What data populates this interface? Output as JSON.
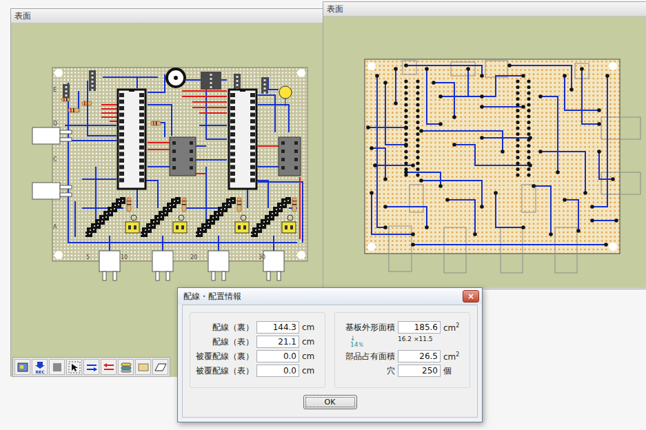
{
  "windows": [
    {
      "title": "表面",
      "kind": "front"
    },
    {
      "title": "表面",
      "kind": "back"
    }
  ],
  "front_board": {
    "row_labels": [
      "E",
      "D",
      "C",
      "A"
    ],
    "column_labels": [
      "5",
      "10",
      "20",
      "30"
    ]
  },
  "toolbar": {
    "rec_label": "REC"
  },
  "dialog": {
    "title": "配線・配置情報",
    "close": "×",
    "wiring": [
      {
        "label": "配線（裏）",
        "value": "144.3",
        "unit": "cm"
      },
      {
        "label": "配線（表）",
        "value": "21.1",
        "unit": "cm"
      },
      {
        "label": "被覆配線（裏）",
        "value": "0.0",
        "unit": "cm"
      },
      {
        "label": "被覆配線（表）",
        "value": "0.0",
        "unit": "cm"
      }
    ],
    "board_area": {
      "label": "基板外形面積",
      "value": "185.6",
      "unit": "cm",
      "unit_sup": "2",
      "dimensions": "16.2 ×11.5"
    },
    "ratio": {
      "arrow": "↓",
      "value": "14％"
    },
    "parts_area": {
      "label": "部品占有面積",
      "value": "26.5",
      "unit": "cm",
      "unit_sup": "2"
    },
    "holes": {
      "label": "穴",
      "value": "250",
      "unit": "個"
    },
    "buttons": [
      "OK"
    ]
  }
}
